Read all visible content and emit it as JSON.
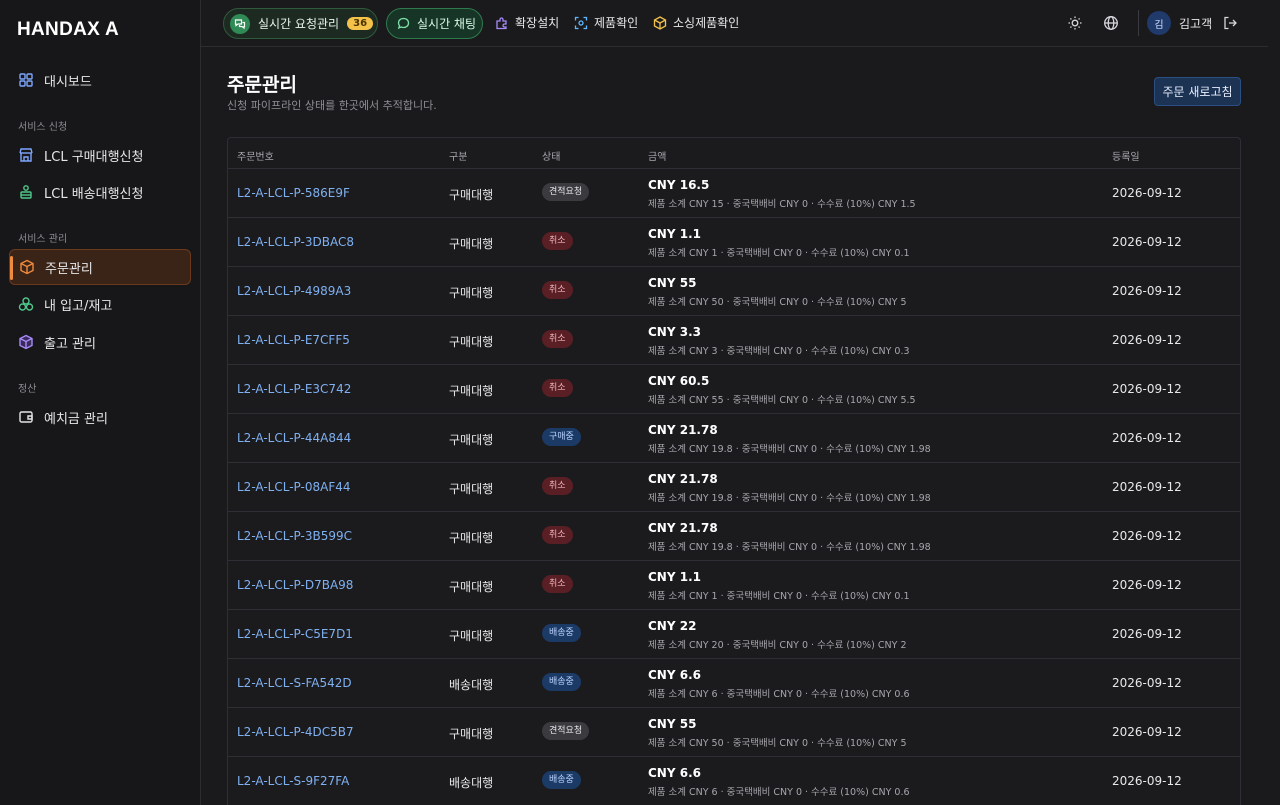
{
  "brand": "HANDAX A",
  "sidebar": {
    "dashboard": "대시보드",
    "section_service_apply": "서비스 신청",
    "lcl_purchase": "LCL 구매대행신청",
    "lcl_shipping": "LCL 배송대행신청",
    "section_service_manage": "서비스 관리",
    "orders": "주문관리",
    "inventory": "내 입고/재고",
    "outbound": "출고 관리",
    "section_settlement": "정산",
    "deposit": "예치금 관리"
  },
  "topbar": {
    "realtime_requests": "실시간 요청관리",
    "requests_count": "36",
    "realtime_chat": "실시간 채팅",
    "extension": "확장설치",
    "product_check": "제품확인",
    "sourcing_check": "소싱제품확인",
    "avatar_initial": "김",
    "username": "김고객"
  },
  "main": {
    "title": "주문관리",
    "subtitle": "신청 파이프라인 상태를 한곳에서 추적합니다.",
    "refresh_button": "주문 새로고침"
  },
  "table": {
    "headers": {
      "order_no": "주문번호",
      "type": "구분",
      "status": "상태",
      "amount": "금액",
      "date": "등록일"
    },
    "rows": [
      {
        "id": "L2-A-LCL-P-586E9F",
        "type": "구매대행",
        "status": "견적요청",
        "amount": "CNY 16.5",
        "detail": "제품 소계 CNY 15 · 중국택배비 CNY 0 · 수수료 (10%) CNY 1.5",
        "date": "2026-09-12"
      },
      {
        "id": "L2-A-LCL-P-3DBAC8",
        "type": "구매대행",
        "status": "취소",
        "amount": "CNY 1.1",
        "detail": "제품 소계 CNY 1 · 중국택배비 CNY 0 · 수수료 (10%) CNY 0.1",
        "date": "2026-09-12"
      },
      {
        "id": "L2-A-LCL-P-4989A3",
        "type": "구매대행",
        "status": "취소",
        "amount": "CNY 55",
        "detail": "제품 소계 CNY 50 · 중국택배비 CNY 0 · 수수료 (10%) CNY 5",
        "date": "2026-09-12"
      },
      {
        "id": "L2-A-LCL-P-E7CFF5",
        "type": "구매대행",
        "status": "취소",
        "amount": "CNY 3.3",
        "detail": "제품 소계 CNY 3 · 중국택배비 CNY 0 · 수수료 (10%) CNY 0.3",
        "date": "2026-09-12"
      },
      {
        "id": "L2-A-LCL-P-E3C742",
        "type": "구매대행",
        "status": "취소",
        "amount": "CNY 60.5",
        "detail": "제품 소계 CNY 55 · 중국택배비 CNY 0 · 수수료 (10%) CNY 5.5",
        "date": "2026-09-12"
      },
      {
        "id": "L2-A-LCL-P-44A844",
        "type": "구매대행",
        "status": "구매중",
        "amount": "CNY 21.78",
        "detail": "제품 소계 CNY 19.8 · 중국택배비 CNY 0 · 수수료 (10%) CNY 1.98",
        "date": "2026-09-12"
      },
      {
        "id": "L2-A-LCL-P-08AF44",
        "type": "구매대행",
        "status": "취소",
        "amount": "CNY 21.78",
        "detail": "제품 소계 CNY 19.8 · 중국택배비 CNY 0 · 수수료 (10%) CNY 1.98",
        "date": "2026-09-12"
      },
      {
        "id": "L2-A-LCL-P-3B599C",
        "type": "구매대행",
        "status": "취소",
        "amount": "CNY 21.78",
        "detail": "제품 소계 CNY 19.8 · 중국택배비 CNY 0 · 수수료 (10%) CNY 1.98",
        "date": "2026-09-12"
      },
      {
        "id": "L2-A-LCL-P-D7BA98",
        "type": "구매대행",
        "status": "취소",
        "amount": "CNY 1.1",
        "detail": "제품 소계 CNY 1 · 중국택배비 CNY 0 · 수수료 (10%) CNY 0.1",
        "date": "2026-09-12"
      },
      {
        "id": "L2-A-LCL-P-C5E7D1",
        "type": "구매대행",
        "status": "배송중",
        "amount": "CNY 22",
        "detail": "제품 소계 CNY 20 · 중국택배비 CNY 0 · 수수료 (10%) CNY 2",
        "date": "2026-09-12"
      },
      {
        "id": "L2-A-LCL-S-FA542D",
        "type": "배송대행",
        "status": "배송중",
        "amount": "CNY 6.6",
        "detail": "제품 소계 CNY 6 · 중국택배비 CNY 0 · 수수료 (10%) CNY 0.6",
        "date": "2026-09-12"
      },
      {
        "id": "L2-A-LCL-P-4DC5B7",
        "type": "구매대행",
        "status": "견적요청",
        "amount": "CNY 55",
        "detail": "제품 소계 CNY 50 · 중국택배비 CNY 0 · 수수료 (10%) CNY 5",
        "date": "2026-09-12"
      },
      {
        "id": "L2-A-LCL-S-9F27FA",
        "type": "배송대행",
        "status": "배송중",
        "amount": "CNY 6.6",
        "detail": "제품 소계 CNY 6 · 중국택배비 CNY 0 · 수수료 (10%) CNY 0.6",
        "date": "2026-09-12"
      }
    ]
  }
}
